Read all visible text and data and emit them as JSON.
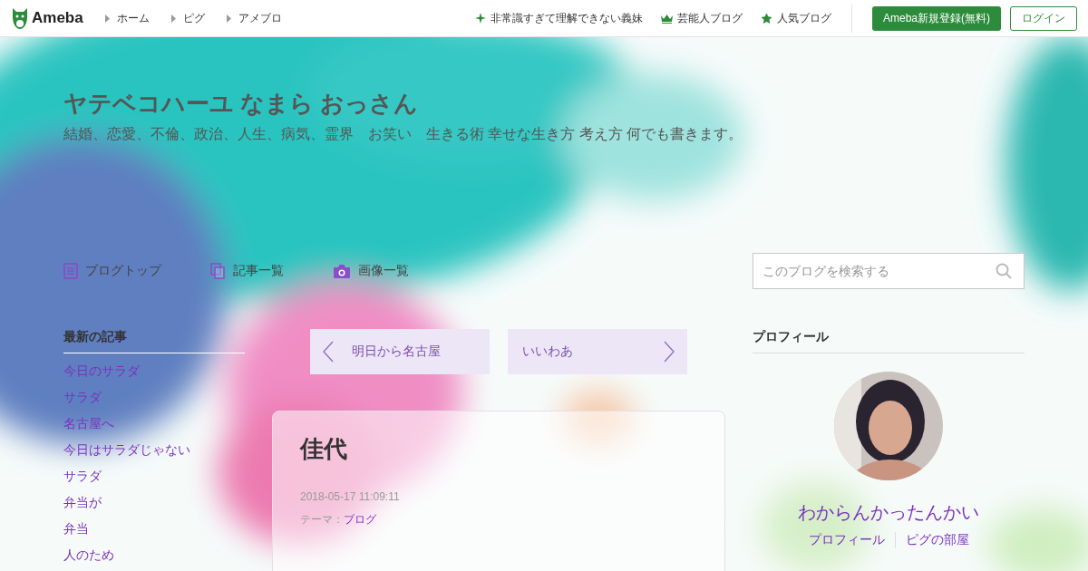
{
  "topbar": {
    "logo": "Ameba",
    "breadcrumbs": [
      "ホーム",
      "ピグ",
      "アメブロ"
    ],
    "links": [
      {
        "kind": "sparkle",
        "label": "非常識すぎて理解できない義妹"
      },
      {
        "kind": "crown",
        "label": "芸能人ブログ"
      },
      {
        "kind": "star",
        "label": "人気ブログ"
      }
    ],
    "register": "Ameba新規登録(無料)",
    "login": "ログイン"
  },
  "header": {
    "title": "ヤテベコハーユ なまら おっさん",
    "subtitle": "結婚、恋愛、不倫、政治、人生、病気、霊界　お笑い　生きる術 幸せな生き方 考え方 何でも書きます。"
  },
  "nav": [
    {
      "kind": "doc",
      "label": "ブログトップ"
    },
    {
      "kind": "copy",
      "label": "記事一覧"
    },
    {
      "kind": "camera",
      "label": "画像一覧"
    }
  ],
  "search": {
    "placeholder": "このブログを検索する"
  },
  "recent": {
    "heading": "最新の記事",
    "items": [
      "今日のサラダ",
      "サラダ",
      "名古屋へ",
      "今日はサラダじゃない",
      "サラダ",
      "弁当が",
      "弁当",
      "人のため"
    ]
  },
  "pager": {
    "prev": "明日から名古屋",
    "next": "いいわあ"
  },
  "article": {
    "title": "佳代",
    "date": "2018-05-17 11:09:11",
    "theme_label": "テーマ：",
    "theme": "ブログ"
  },
  "profile": {
    "heading": "プロフィール",
    "avatar": {
      "kind": "picture"
    },
    "name": "わからんかったんかい",
    "links": [
      "プロフィール",
      "ピグの部屋"
    ]
  }
}
